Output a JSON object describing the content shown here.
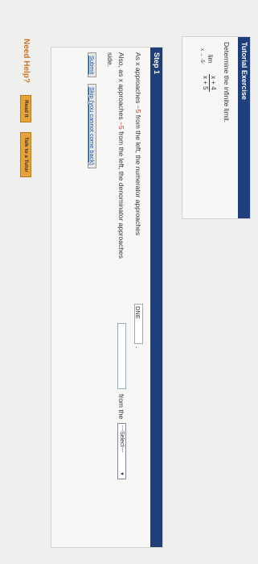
{
  "tutorial": {
    "header": "Tutorial Exercise",
    "instruction": "Determine the infinite limit.",
    "lim": "lim",
    "lim_sub": "x → -5⁻",
    "numerator": "x + 4",
    "denominator": "x + 5"
  },
  "step": {
    "header": "Step 1",
    "line1_prefix": "As x approaches",
    "line1_value": "−5",
    "line1_suffix": "from the left, the numerator approaches",
    "numerator_answer": "DNE",
    "line2_prefix": "Also, as x approaches",
    "line2_value": "−5",
    "line2_suffix": "from the left, the denominator approaches",
    "denominator_answer": "",
    "line2_tail": "from the",
    "select_value": "---Select---",
    "line3": "side.",
    "submit_label": "Submit",
    "skip_label": "Skip (you cannot come back)"
  },
  "help": {
    "label": "Need Help?",
    "read_it": "Read It",
    "talk_to_tutor": "Talk to a Tutor"
  },
  "colors": {
    "header_bg": "#1f3f7a",
    "accent_orange": "#e8a23a"
  }
}
